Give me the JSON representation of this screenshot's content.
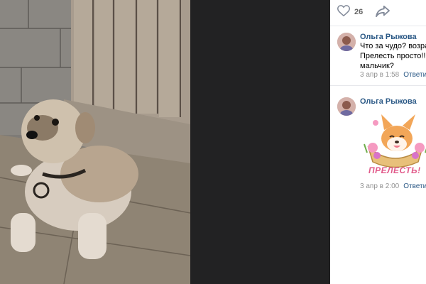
{
  "post": {
    "likes": "26"
  },
  "comments": [
    {
      "author": "Ольга Рыжова",
      "lines": [
        "Что за чудо? возраст",
        "Прелесть просто!!! Д",
        "мальчик?"
      ],
      "date": "3 апр в 1:58",
      "reply": "Ответить"
    },
    {
      "author": "Ольга Рыжова",
      "sticker_text": "ПРЕЛЕСТЬ!",
      "date": "3 апр в 2:00",
      "reply": "Ответить"
    }
  ],
  "colors": {
    "link": "#2a5885",
    "meta": "#939393",
    "viewer_bg": "#222223"
  },
  "icons": [
    "heart-icon",
    "share-icon"
  ]
}
